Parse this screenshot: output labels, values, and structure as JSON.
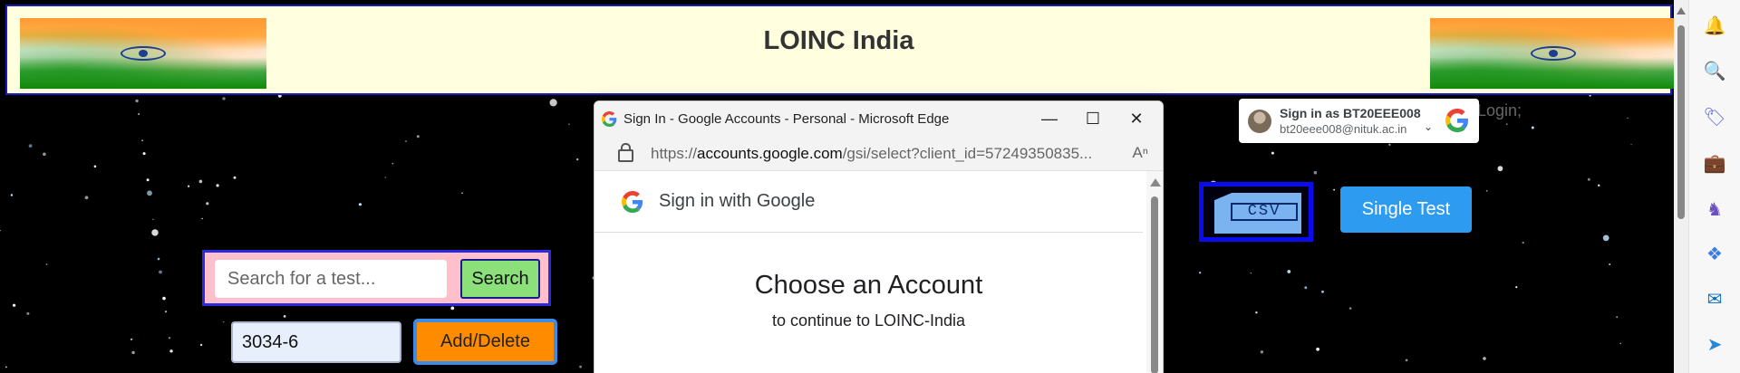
{
  "header": {
    "title": "LOINC India"
  },
  "search": {
    "placeholder": "Search for a test...",
    "button_label": "Search"
  },
  "test_code": {
    "value": "3034-6"
  },
  "add_delete": {
    "label": "Add/Delete"
  },
  "csv": {
    "label": "CSV"
  },
  "single_test": {
    "label": "Single Test"
  },
  "login_text": "Login;",
  "gsi_chip": {
    "name": "Sign in as BT20EEE008",
    "email": "bt20eee008@nituk.ac.in"
  },
  "popup": {
    "window_title": "Sign In - Google Accounts - Personal - Microsoft Edge",
    "url_prefix": "https://",
    "url_domain": "accounts.google.com",
    "url_rest": "/gsi/select?client_id=57249350835...",
    "gsi_header": "Sign in with Google",
    "choose_title": "Choose an Account",
    "choose_subtitle": "to continue to LOINC-India"
  },
  "icons": {
    "sidebar": [
      "bell-icon",
      "search-icon",
      "tag-icon",
      "briefcase-icon",
      "chess-icon",
      "copilot-icon",
      "outlook-icon",
      "send-icon"
    ]
  },
  "colors": {
    "header_bg": "#ffffe0",
    "search_box_bg": "#ffc0cb",
    "search_button_bg": "#8be07a",
    "add_delete_bg": "#ff8c00",
    "single_test_bg": "#2d9bf0"
  }
}
